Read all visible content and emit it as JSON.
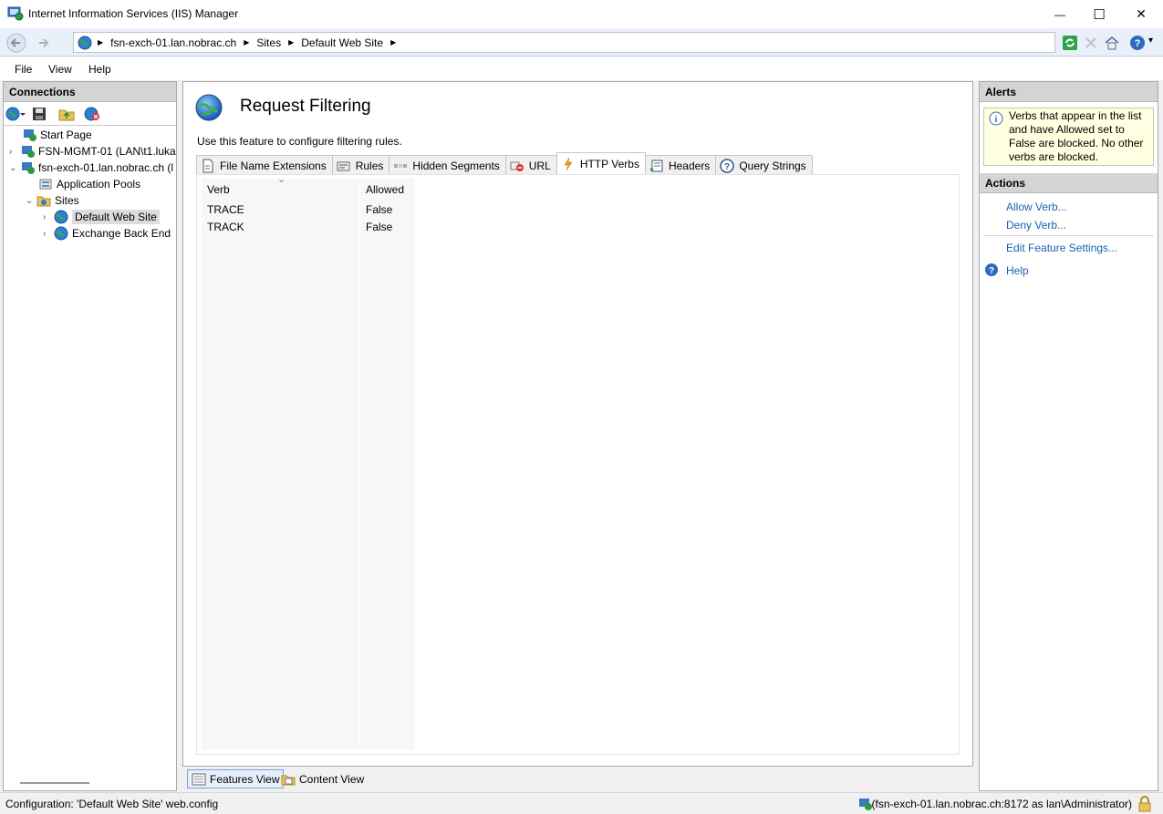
{
  "window": {
    "title": "Internet Information Services (IIS) Manager",
    "minimize_glyph": "—",
    "maximize_glyph": "☐",
    "close_glyph": "✕"
  },
  "address": {
    "crumbs": [
      "fsn-exch-01.lan.nobrac.ch",
      "Sites",
      "Default Web Site"
    ],
    "sep_glyph": "▶",
    "help_arrow": "▾"
  },
  "menu": {
    "file": "File",
    "view": "View",
    "help": "Help"
  },
  "connections": {
    "header": "Connections",
    "tree": {
      "start_page": "Start Page",
      "mgmt_server": "FSN-MGMT-01 (LAN\\t1.luka",
      "exch_server": "fsn-exch-01.lan.nobrac.ch (l",
      "app_pools": "Application Pools",
      "sites": "Sites",
      "default_site": "Default Web Site",
      "exchange_backend": "Exchange Back End"
    }
  },
  "feature": {
    "title": "Request Filtering",
    "description": "Use this feature to configure filtering rules.",
    "tabs": [
      "File Name Extensions",
      "Rules",
      "Hidden Segments",
      "URL",
      "HTTP Verbs",
      "Headers",
      "Query Strings"
    ],
    "active_tab": "HTTP Verbs",
    "grid": {
      "columns": [
        "Verb",
        "Allowed"
      ],
      "sort_glyph": "⌄",
      "rows": [
        {
          "verb": "TRACE",
          "allowed": "False"
        },
        {
          "verb": "TRACK",
          "allowed": "False"
        }
      ]
    }
  },
  "views": {
    "features": "Features View",
    "content": "Content View"
  },
  "alerts": {
    "header": "Alerts",
    "message": "Verbs that appear in the list and have Allowed set to False are blocked. No other verbs are blocked."
  },
  "actions": {
    "header": "Actions",
    "allow": "Allow Verb...",
    "deny": "Deny Verb...",
    "edit": "Edit Feature Settings...",
    "help": "Help"
  },
  "status": {
    "config": "Configuration: 'Default Web Site' web.config",
    "connection": "(fsn-exch-01.lan.nobrac.ch:8172 as lan\\Administrator)"
  },
  "colors": {
    "link": "#1a5fb4",
    "alert_bg": "#ffffe1",
    "panel_header": "#d4d4d4"
  }
}
